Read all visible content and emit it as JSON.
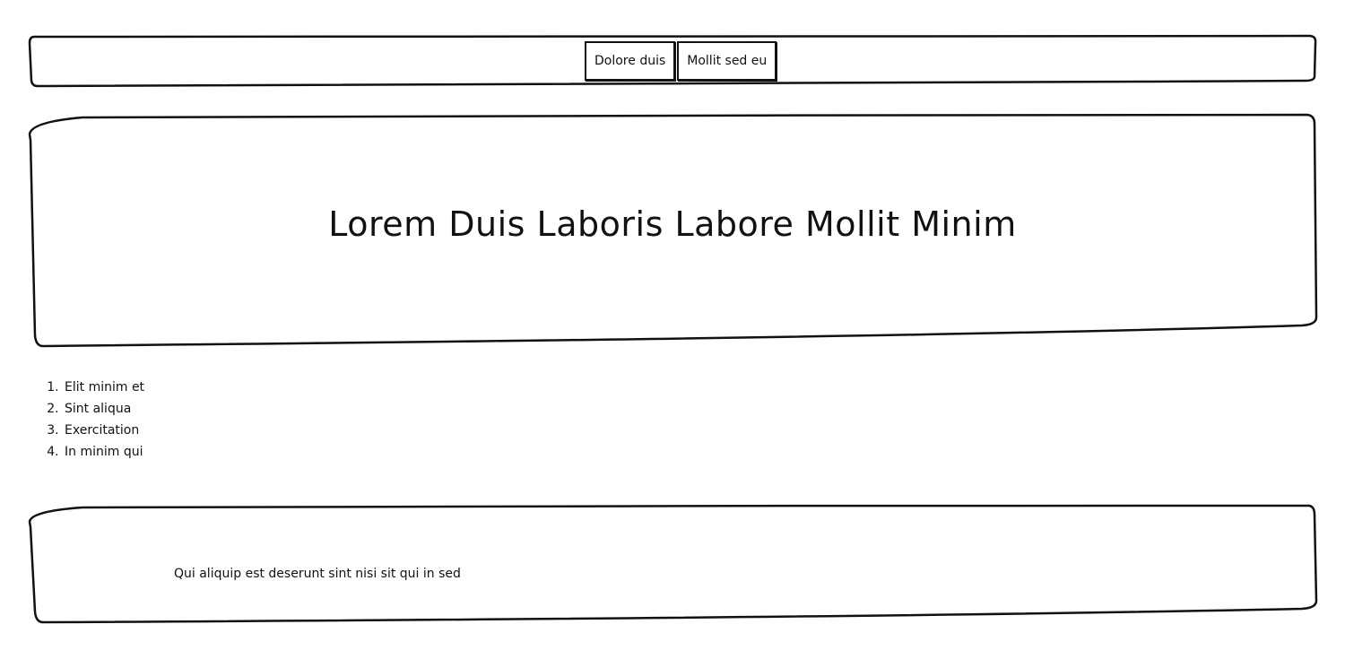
{
  "nav": {
    "buttons": [
      {
        "label": "Dolore duis"
      },
      {
        "label": "Mollit sed eu"
      }
    ]
  },
  "hero": {
    "title": "Lorem Duis Laboris Labore Mollit Minim"
  },
  "list": {
    "items": [
      {
        "label": "Elit minim et"
      },
      {
        "label": "Sint aliqua"
      },
      {
        "label": "Exercitation"
      },
      {
        "label": "In minim qui"
      }
    ]
  },
  "footer": {
    "text": "Qui aliquip est deserunt sint nisi sit qui in sed"
  }
}
